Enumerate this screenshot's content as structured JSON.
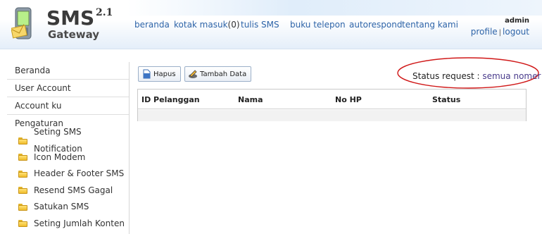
{
  "app": {
    "logo_title": "SMS",
    "logo_version": "2.1",
    "logo_subtitle": "Gateway"
  },
  "nav": {
    "items": [
      {
        "label": "beranda"
      },
      {
        "label": "kotak masuk"
      },
      {
        "label": "tulis SMS"
      },
      {
        "label": "buku telepon"
      },
      {
        "label": "autorespond"
      },
      {
        "label": "tentang kami"
      }
    ],
    "inbox_count": "(0)"
  },
  "user": {
    "name": "admin",
    "profile_label": "profile",
    "separator": "|",
    "logout_label": "logout"
  },
  "sidebar": {
    "items": [
      {
        "label": "Beranda"
      },
      {
        "label": "User Account"
      },
      {
        "label": "Account ku"
      },
      {
        "label": "Pengaturan"
      }
    ],
    "sub_items": [
      {
        "label": "Seting SMS Notification"
      },
      {
        "label": "Icon Modem"
      },
      {
        "label": "Header & Footer SMS"
      },
      {
        "label": "Resend SMS Gagal"
      },
      {
        "label": "Satukan SMS"
      },
      {
        "label": "Seting Jumlah Konten"
      }
    ]
  },
  "toolbar": {
    "delete_label": "Hapus",
    "add_label": "Tambah Data"
  },
  "status_request": {
    "label": "Status request :",
    "value": "semua nomer"
  },
  "table": {
    "columns": [
      "ID Pelanggan",
      "Nama",
      "No HP",
      "Status"
    ],
    "rows": []
  },
  "colors": {
    "link": "#2e64a8",
    "highlight_ellipse": "#d01818",
    "status_value": "#4a3c8c"
  }
}
